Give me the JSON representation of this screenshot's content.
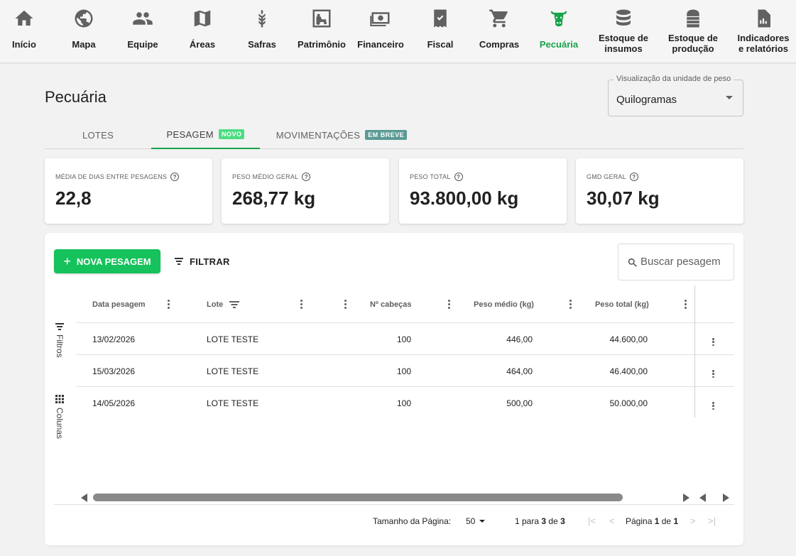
{
  "nav": {
    "items": [
      {
        "label": "Início",
        "icon": "home-icon"
      },
      {
        "label": "Mapa",
        "icon": "globe-icon"
      },
      {
        "label": "Equipe",
        "icon": "team-icon"
      },
      {
        "label": "Áreas",
        "icon": "map-icon"
      },
      {
        "label": "Safras",
        "icon": "wheat-icon"
      },
      {
        "label": "Patrimônio",
        "icon": "tractor-icon"
      },
      {
        "label": "Financeiro",
        "icon": "money-icon"
      },
      {
        "label": "Fiscal",
        "icon": "receipt-icon"
      },
      {
        "label": "Compras",
        "icon": "cart-icon"
      },
      {
        "label": "Pecuária",
        "icon": "cow-icon",
        "active": true
      },
      {
        "label_line1": "Estoque de",
        "label_line2": "insumos",
        "icon": "database-icon"
      },
      {
        "label_line1": "Estoque de",
        "label_line2": "produção",
        "icon": "silo-icon"
      },
      {
        "label_line1": "Indicadores",
        "label_line2": "e relatórios",
        "icon": "report-icon"
      }
    ]
  },
  "page": {
    "title": "Pecuária",
    "unit_select": {
      "legend": "Visualização da unidade de peso",
      "value": "Quilogramas"
    }
  },
  "tabs": [
    {
      "label": "LOTES"
    },
    {
      "label": "PESAGEM",
      "badge": "NOVO",
      "active": true
    },
    {
      "label": "MOVIMENTAÇÕES",
      "badge": "EM BREVE"
    }
  ],
  "stats": [
    {
      "label": "MÉDIA DE DIAS ENTRE PESAGENS",
      "value": "22,8"
    },
    {
      "label": "PESO MÉDIO GERAL",
      "value": "268,77 kg"
    },
    {
      "label": "PESO TOTAL",
      "value": "93.800,00 kg"
    },
    {
      "label": "GMD GERAL",
      "value": "30,07 kg"
    }
  ],
  "toolbar": {
    "new_label": "NOVA PESAGEM",
    "filter_label": "FILTRAR",
    "search_placeholder": "Buscar pesagem"
  },
  "side_tools": {
    "filters_label": "Filtros",
    "columns_label": "Colunas"
  },
  "grid": {
    "columns": [
      "Data pesagem",
      "Lote",
      "Nº cabeças",
      "Peso médio (kg)",
      "Peso total (kg)"
    ],
    "rows": [
      {
        "date": "13/02/2026",
        "lote": "LOTE TESTE",
        "heads": "100",
        "avg": "446,00",
        "total": "44.600,00"
      },
      {
        "date": "15/03/2026",
        "lote": "LOTE TESTE",
        "heads": "100",
        "avg": "464,00",
        "total": "46.400,00"
      },
      {
        "date": "14/05/2026",
        "lote": "LOTE TESTE",
        "heads": "100",
        "avg": "500,00",
        "total": "50.000,00"
      }
    ]
  },
  "pagination": {
    "page_size_label": "Tamanho da Página:",
    "page_size": "50",
    "range_prefix": "1 para",
    "range_to": "3",
    "range_mid": "de",
    "range_total": "3",
    "page_prefix": "Página",
    "page_current": "1",
    "page_mid": "de",
    "page_total": "1"
  },
  "colors": {
    "accent": "#16c25b",
    "active_nav": "#16a34a",
    "badge_new": "#4ade80",
    "badge_soon": "#5b9a94"
  }
}
